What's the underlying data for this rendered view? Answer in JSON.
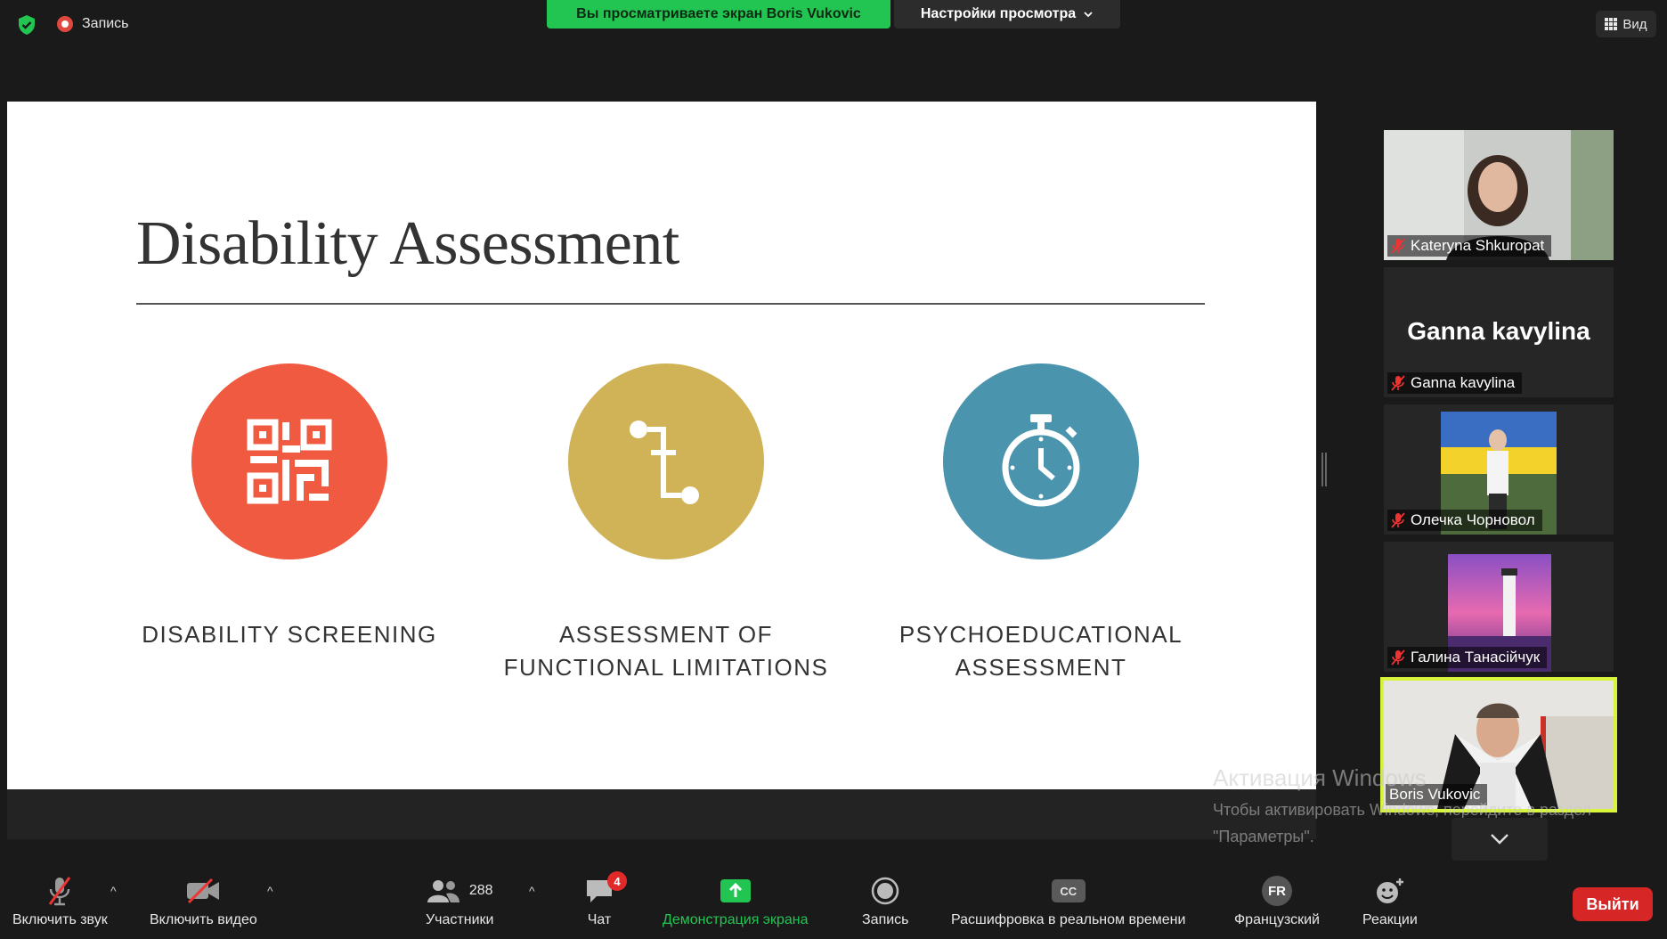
{
  "topbar": {
    "recording_label": "Запись",
    "sharing_banner": "Вы просматриваете экран Boris Vukovic",
    "view_settings": "Настройки просмотра",
    "view_label": "Вид"
  },
  "slide": {
    "title": "Disability Assessment",
    "items": [
      {
        "line1": "DISABILITY SCREENING",
        "line2": ""
      },
      {
        "line1": "ASSESSMENT OF",
        "line2": "FUNCTIONAL LIMITATIONS"
      },
      {
        "line1": "PSYCHOEDUCATIONAL",
        "line2": "ASSESSMENT"
      }
    ],
    "colors": {
      "red": "#ef5a40",
      "gold": "#cfb356",
      "blue": "#4a94ad"
    }
  },
  "participants": [
    {
      "name": "Kateryna Shkuropat"
    },
    {
      "name": "Ganna kavylina",
      "display": "Ganna kavylina"
    },
    {
      "name": "Олечка Чорновол"
    },
    {
      "name": "Галина Танасійчук"
    },
    {
      "name": "Boris Vukovic"
    }
  ],
  "watermark": {
    "title": "Активация Windows",
    "subtitle": "Чтобы активировать Windows, перейдите в раздел \"Параметры\"."
  },
  "toolbar": {
    "mute": "Включить звук",
    "video": "Включить видео",
    "participants": "Участники",
    "participants_count": "288",
    "chat": "Чат",
    "chat_badge": "4",
    "share": "Демонстрация экрана",
    "record": "Запись",
    "captions": "Расшифровка в реальном времени",
    "cc": "CC",
    "language": "Французский",
    "language_code": "FR",
    "reactions": "Реакции",
    "leave": "Выйти"
  }
}
